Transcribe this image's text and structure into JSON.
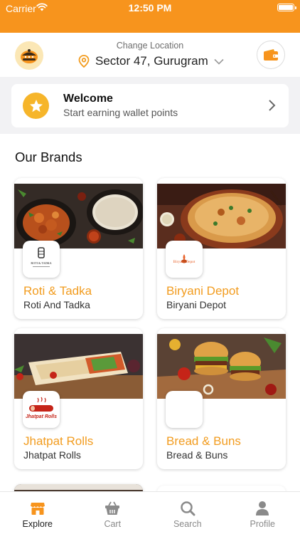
{
  "status_bar": {
    "carrier": "Carrier",
    "time": "12:50 PM"
  },
  "header": {
    "change_location_label": "Change Location",
    "location": "Sector 47, Gurugram"
  },
  "welcome": {
    "title": "Welcome",
    "subtitle": "Start earning wallet points"
  },
  "brands_section": {
    "title": "Our Brands",
    "brands": [
      {
        "name": "Roti & Tadka",
        "subtitle": "Roti And Tadka",
        "logo_text": "ROTI & TADKA"
      },
      {
        "name": "Biryani Depot",
        "subtitle": "Biryani Depot",
        "logo_text": "Biryani Depot"
      },
      {
        "name": "Jhatpat Rolls",
        "subtitle": "Jhatpat Rolls",
        "logo_text": "Jhatpat Rolls"
      },
      {
        "name": "Bread & Buns",
        "subtitle": "Bread & Buns",
        "logo_text": ""
      }
    ]
  },
  "tabbar": {
    "tabs": [
      {
        "label": "Explore",
        "icon": "store-icon",
        "active": true
      },
      {
        "label": "Cart",
        "icon": "basket-icon",
        "active": false
      },
      {
        "label": "Search",
        "icon": "search-icon",
        "active": false
      },
      {
        "label": "Profile",
        "icon": "user-icon",
        "active": false
      }
    ]
  },
  "colors": {
    "accent": "#f7941d",
    "brand_text": "#f29c1f",
    "star": "#f6b52a"
  }
}
